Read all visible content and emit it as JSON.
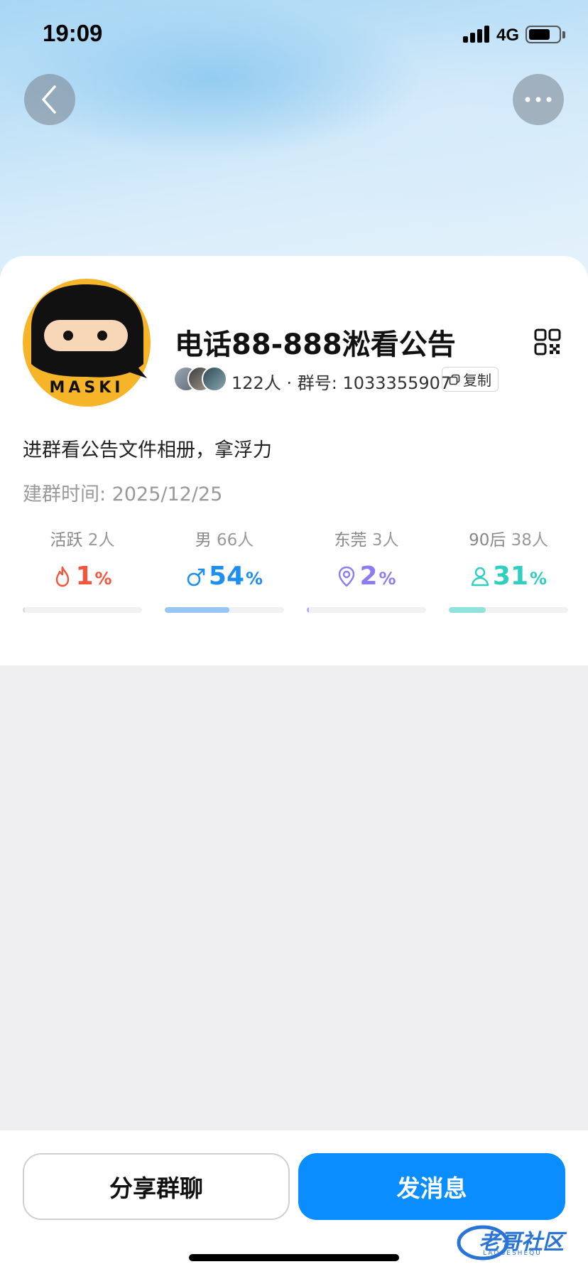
{
  "status_bar": {
    "time": "19:09",
    "network": "4G",
    "battery_level": 0.7
  },
  "nav": {
    "back_icon": "chevron-left-icon",
    "more_icon": "ellipsis-icon"
  },
  "group": {
    "avatar_text": "MASKI",
    "name": "电话88-888淞看公告",
    "member_count": "122人",
    "separator": "·",
    "group_number_label": "群号:",
    "group_number": "1033355907",
    "copy_label": "复制",
    "intro": "进群看公告文件相册，拿浮力",
    "created": "建群时间: 2025/12/25"
  },
  "stats": [
    {
      "label_main": "活跃",
      "label_count": "2人",
      "value": "1",
      "unit": "%",
      "icon": "flame-icon",
      "color": "#f4553d",
      "bar_color": "#dadce0",
      "fraction": 0.01
    },
    {
      "label_main": "男",
      "label_count": "66人",
      "value": "54",
      "unit": "%",
      "icon": "male-icon",
      "color": "#1c8ff0",
      "bar_color": "#97c6f2",
      "fraction": 0.54
    },
    {
      "label_main": "东莞",
      "label_count": "3人",
      "value": "2",
      "unit": "%",
      "icon": "location-pin-icon",
      "color": "#8b7cf0",
      "bar_color": "#b3aaf5",
      "fraction": 0.02
    },
    {
      "label_main": "90后",
      "label_count": "38人",
      "value": "31",
      "unit": "%",
      "icon": "person-icon",
      "color": "#2fcfbf",
      "bar_color": "#8fe3da",
      "fraction": 0.31
    }
  ],
  "actions": {
    "share_label": "分享群聊",
    "send_label": "发消息"
  },
  "watermark": {
    "text": "老哥社区",
    "sub": "LAOGESHEQU"
  },
  "colors": {
    "accent": "#0a8dff",
    "avatar_bg": "#f6b429"
  }
}
